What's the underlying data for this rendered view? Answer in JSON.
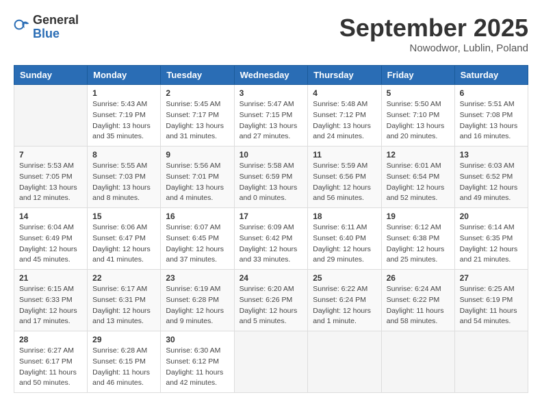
{
  "header": {
    "logo_general": "General",
    "logo_blue": "Blue",
    "month": "September 2025",
    "location": "Nowodwor, Lublin, Poland"
  },
  "weekdays": [
    "Sunday",
    "Monday",
    "Tuesday",
    "Wednesday",
    "Thursday",
    "Friday",
    "Saturday"
  ],
  "weeks": [
    [
      {
        "day": "",
        "info": ""
      },
      {
        "day": "1",
        "info": "Sunrise: 5:43 AM\nSunset: 7:19 PM\nDaylight: 13 hours\nand 35 minutes."
      },
      {
        "day": "2",
        "info": "Sunrise: 5:45 AM\nSunset: 7:17 PM\nDaylight: 13 hours\nand 31 minutes."
      },
      {
        "day": "3",
        "info": "Sunrise: 5:47 AM\nSunset: 7:15 PM\nDaylight: 13 hours\nand 27 minutes."
      },
      {
        "day": "4",
        "info": "Sunrise: 5:48 AM\nSunset: 7:12 PM\nDaylight: 13 hours\nand 24 minutes."
      },
      {
        "day": "5",
        "info": "Sunrise: 5:50 AM\nSunset: 7:10 PM\nDaylight: 13 hours\nand 20 minutes."
      },
      {
        "day": "6",
        "info": "Sunrise: 5:51 AM\nSunset: 7:08 PM\nDaylight: 13 hours\nand 16 minutes."
      }
    ],
    [
      {
        "day": "7",
        "info": "Sunrise: 5:53 AM\nSunset: 7:05 PM\nDaylight: 13 hours\nand 12 minutes."
      },
      {
        "day": "8",
        "info": "Sunrise: 5:55 AM\nSunset: 7:03 PM\nDaylight: 13 hours\nand 8 minutes."
      },
      {
        "day": "9",
        "info": "Sunrise: 5:56 AM\nSunset: 7:01 PM\nDaylight: 13 hours\nand 4 minutes."
      },
      {
        "day": "10",
        "info": "Sunrise: 5:58 AM\nSunset: 6:59 PM\nDaylight: 13 hours\nand 0 minutes."
      },
      {
        "day": "11",
        "info": "Sunrise: 5:59 AM\nSunset: 6:56 PM\nDaylight: 12 hours\nand 56 minutes."
      },
      {
        "day": "12",
        "info": "Sunrise: 6:01 AM\nSunset: 6:54 PM\nDaylight: 12 hours\nand 52 minutes."
      },
      {
        "day": "13",
        "info": "Sunrise: 6:03 AM\nSunset: 6:52 PM\nDaylight: 12 hours\nand 49 minutes."
      }
    ],
    [
      {
        "day": "14",
        "info": "Sunrise: 6:04 AM\nSunset: 6:49 PM\nDaylight: 12 hours\nand 45 minutes."
      },
      {
        "day": "15",
        "info": "Sunrise: 6:06 AM\nSunset: 6:47 PM\nDaylight: 12 hours\nand 41 minutes."
      },
      {
        "day": "16",
        "info": "Sunrise: 6:07 AM\nSunset: 6:45 PM\nDaylight: 12 hours\nand 37 minutes."
      },
      {
        "day": "17",
        "info": "Sunrise: 6:09 AM\nSunset: 6:42 PM\nDaylight: 12 hours\nand 33 minutes."
      },
      {
        "day": "18",
        "info": "Sunrise: 6:11 AM\nSunset: 6:40 PM\nDaylight: 12 hours\nand 29 minutes."
      },
      {
        "day": "19",
        "info": "Sunrise: 6:12 AM\nSunset: 6:38 PM\nDaylight: 12 hours\nand 25 minutes."
      },
      {
        "day": "20",
        "info": "Sunrise: 6:14 AM\nSunset: 6:35 PM\nDaylight: 12 hours\nand 21 minutes."
      }
    ],
    [
      {
        "day": "21",
        "info": "Sunrise: 6:15 AM\nSunset: 6:33 PM\nDaylight: 12 hours\nand 17 minutes."
      },
      {
        "day": "22",
        "info": "Sunrise: 6:17 AM\nSunset: 6:31 PM\nDaylight: 12 hours\nand 13 minutes."
      },
      {
        "day": "23",
        "info": "Sunrise: 6:19 AM\nSunset: 6:28 PM\nDaylight: 12 hours\nand 9 minutes."
      },
      {
        "day": "24",
        "info": "Sunrise: 6:20 AM\nSunset: 6:26 PM\nDaylight: 12 hours\nand 5 minutes."
      },
      {
        "day": "25",
        "info": "Sunrise: 6:22 AM\nSunset: 6:24 PM\nDaylight: 12 hours\nand 1 minute."
      },
      {
        "day": "26",
        "info": "Sunrise: 6:24 AM\nSunset: 6:22 PM\nDaylight: 11 hours\nand 58 minutes."
      },
      {
        "day": "27",
        "info": "Sunrise: 6:25 AM\nSunset: 6:19 PM\nDaylight: 11 hours\nand 54 minutes."
      }
    ],
    [
      {
        "day": "28",
        "info": "Sunrise: 6:27 AM\nSunset: 6:17 PM\nDaylight: 11 hours\nand 50 minutes."
      },
      {
        "day": "29",
        "info": "Sunrise: 6:28 AM\nSunset: 6:15 PM\nDaylight: 11 hours\nand 46 minutes."
      },
      {
        "day": "30",
        "info": "Sunrise: 6:30 AM\nSunset: 6:12 PM\nDaylight: 11 hours\nand 42 minutes."
      },
      {
        "day": "",
        "info": ""
      },
      {
        "day": "",
        "info": ""
      },
      {
        "day": "",
        "info": ""
      },
      {
        "day": "",
        "info": ""
      }
    ]
  ]
}
